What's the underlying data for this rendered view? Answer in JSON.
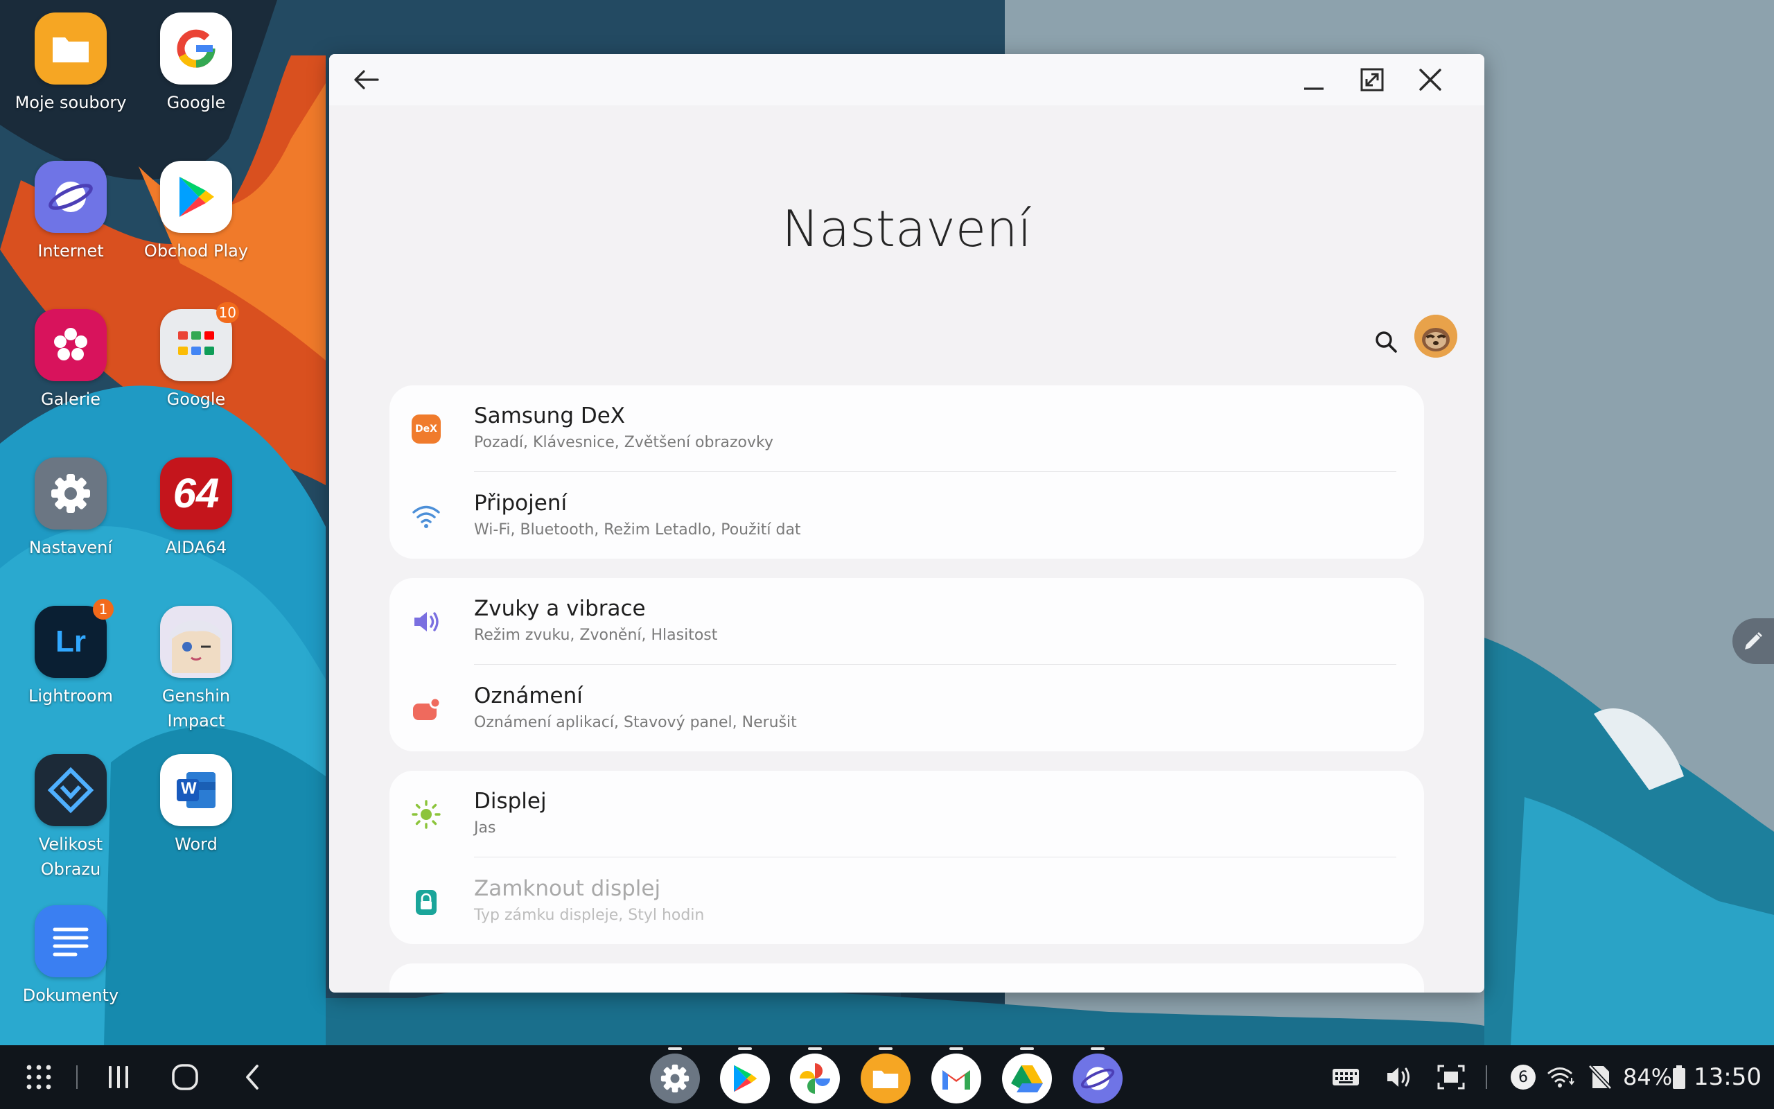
{
  "desktop": {
    "icons": [
      {
        "label": "Moje soubory",
        "icon": "my-files-icon"
      },
      {
        "label": "Google",
        "icon": "google-icon"
      },
      {
        "label": "Internet",
        "icon": "samsung-internet-icon"
      },
      {
        "label": "Obchod Play",
        "icon": "play-store-icon"
      },
      {
        "label": "Galerie",
        "icon": "gallery-icon"
      },
      {
        "label": "Google",
        "icon": "google-folder-icon",
        "badge": "10"
      },
      {
        "label": "Nastavení",
        "icon": "settings-icon"
      },
      {
        "label": "AIDA64",
        "icon": "aida64-icon",
        "glyph": "64"
      },
      {
        "label": "Lightroom",
        "icon": "lightroom-icon",
        "badge": "1",
        "glyph": "Lr"
      },
      {
        "label": "Genshin Impact",
        "icon": "genshin-impact-icon"
      },
      {
        "label": "Velikost Obrazu",
        "icon": "image-size-icon"
      },
      {
        "label": "Word",
        "icon": "word-icon",
        "glyph": "W"
      },
      {
        "label": "Dokumenty",
        "icon": "docs-icon"
      }
    ]
  },
  "window": {
    "title": "Nastavení",
    "sections": [
      {
        "items": [
          {
            "title": "Samsung DeX",
            "subtitle": "Pozadí, Klávesnice, Zvětšení obrazovky",
            "icon": "dex-icon",
            "glyph": "DeX",
            "color": "#f07b2c"
          },
          {
            "title": "Připojení",
            "subtitle": "Wi-Fi, Bluetooth, Režim Letadlo, Použití dat",
            "icon": "wifi-icon",
            "color": "#4c8fd8"
          }
        ]
      },
      {
        "items": [
          {
            "title": "Zvuky a vibrace",
            "subtitle": "Režim zvuku, Zvonění, Hlasitost",
            "icon": "volume-icon",
            "color": "#7a6fe0"
          },
          {
            "title": "Oznámení",
            "subtitle": "Oznámení aplikací, Stavový panel, Nerušit",
            "icon": "notification-icon",
            "color": "#ef6a5d"
          }
        ]
      },
      {
        "items": [
          {
            "title": "Displej",
            "subtitle": "Jas",
            "icon": "brightness-icon",
            "color": "#8cc43b"
          },
          {
            "title": "Zamknout displej",
            "subtitle": "Typ zámku displeje, Styl hodin",
            "icon": "lock-icon",
            "color": "#1aa59a",
            "dimmed": true
          }
        ]
      }
    ]
  },
  "taskbar": {
    "dock_apps": [
      "settings-icon",
      "play-store-icon",
      "photos-icon",
      "my-files-icon",
      "gmail-icon",
      "drive-icon",
      "samsung-internet-icon"
    ],
    "notification_count": "6",
    "battery": "84%",
    "time": "13:50"
  }
}
